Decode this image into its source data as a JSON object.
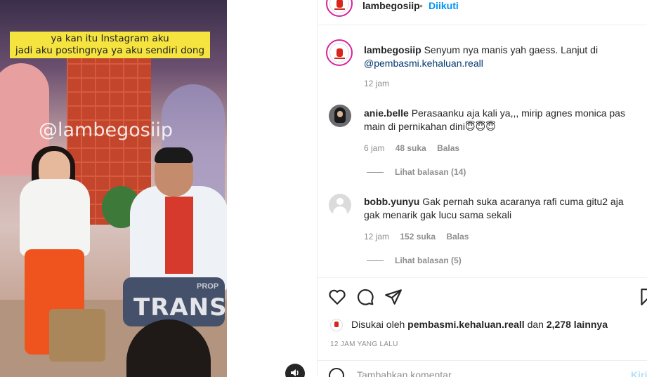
{
  "video": {
    "caption_line1": "ya kan itu Instagram aku",
    "caption_line2": "jadi aku postingnya ya aku sendiri dong",
    "watermark": "@lambegosiip",
    "channel_logo": "TRANS",
    "channel_sub": "PROP",
    "audio_icon": "speaker-icon"
  },
  "header": {
    "username": "lambegosiip",
    "separator": "•",
    "follow_status": "Diikuti"
  },
  "post_caption": {
    "username": "lambegosiip",
    "text": "Senyum nya manis yah gaess. Lanjut di",
    "mention": "@pembasmi.kehaluan.reall",
    "time": "12 jam"
  },
  "comments": [
    {
      "username": "anie.belle",
      "text": "Perasaanku aja kali ya,,, mirip agnes monica pas main di pernikahan dini😇😇😇",
      "time": "6 jam",
      "likes": "48 suka",
      "reply": "Balas",
      "view_replies": "Lihat balasan (14)"
    },
    {
      "username": "bobb.yunyu",
      "text": "Gak pernah suka acaranya rafi cuma gitu2 aja gak menarik gak lucu sama sekali",
      "time": "12 jam",
      "likes": "152 suka",
      "reply": "Balas",
      "view_replies": "Lihat balasan (5)"
    }
  ],
  "actions": {
    "like_icon": "heart-icon",
    "comment_icon": "comment-icon",
    "share_icon": "send-icon",
    "save_icon": "bookmark-icon"
  },
  "likes": {
    "prefix": "Disukai oleh",
    "user": "pembasmi.kehaluan.reall",
    "middle": "dan",
    "count": "2,278 lainnya"
  },
  "posted_time": "12 JAM YANG LALU",
  "comment_box": {
    "placeholder": "Tambahkan komentar...",
    "post_label": "Kirim"
  }
}
